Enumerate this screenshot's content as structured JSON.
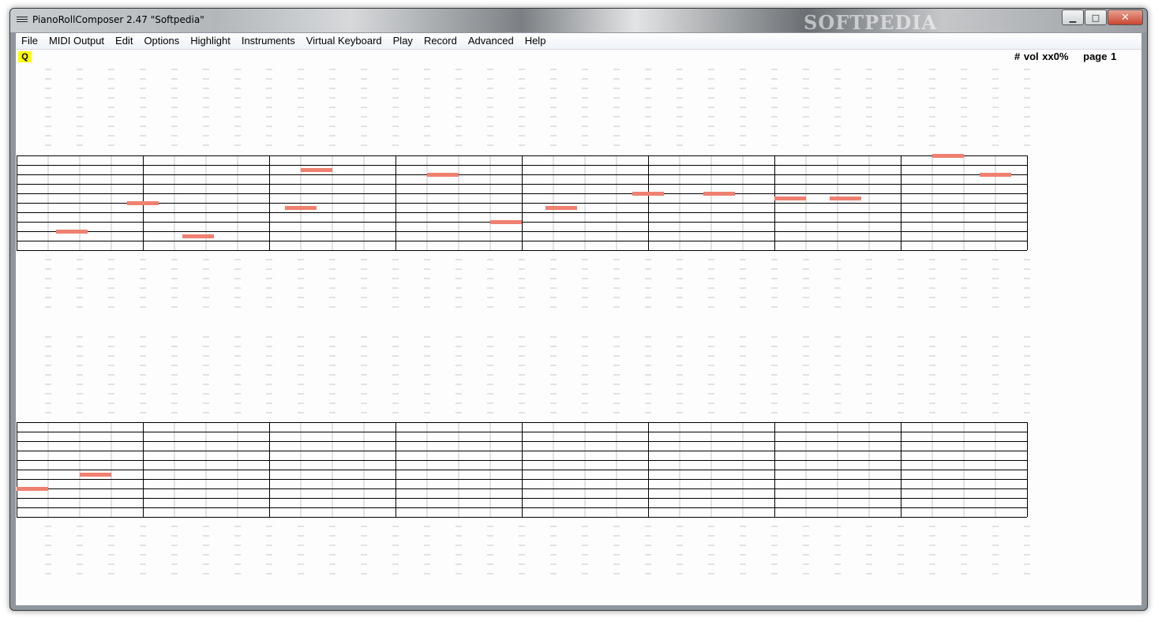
{
  "window": {
    "title": "PianoRollComposer 2.47  \"Softpedia\"",
    "watermark": "SOFTPEDIA",
    "buttons": {
      "minimize": "minimize-icon",
      "maximize": "maximize-icon",
      "close": "close-icon"
    }
  },
  "menu": [
    "File",
    "MIDI Output",
    "Edit",
    "Options",
    "Highlight",
    "Instruments",
    "Virtual Keyboard",
    "Play",
    "Record",
    "Advanced",
    "Help"
  ],
  "toolbar": {
    "q_label": "Q"
  },
  "status": {
    "accidental": "#",
    "volume": "vol xx0%",
    "page": "page 1"
  },
  "colors": {
    "note": "#f08070",
    "staff": "#000000",
    "guide": "#c8c8c8",
    "q_badge": "#ffff00"
  },
  "systems": [
    {
      "measures": 8,
      "notes": [
        {
          "beat": 1.75,
          "line": 8
        },
        {
          "beat": 4,
          "line": 5
        },
        {
          "beat": 5.75,
          "line": 8.5
        },
        {
          "beat": 9,
          "line": 5.5
        },
        {
          "beat": 9.5,
          "line": 1.5
        },
        {
          "beat": 13.5,
          "line": 2
        },
        {
          "beat": 15.5,
          "line": 7
        },
        {
          "beat": 17.25,
          "line": 5.5
        },
        {
          "beat": 20,
          "line": 4
        },
        {
          "beat": 22.25,
          "line": 4
        },
        {
          "beat": 24.5,
          "line": 4.5
        },
        {
          "beat": 26.25,
          "line": 4.5
        },
        {
          "beat": 29.5,
          "line": 0
        },
        {
          "beat": 31,
          "line": 2
        }
      ]
    },
    {
      "measures": 8,
      "notes": [
        {
          "beat": 0.5,
          "line": 7
        },
        {
          "beat": 2.5,
          "line": 5.5
        }
      ]
    }
  ]
}
